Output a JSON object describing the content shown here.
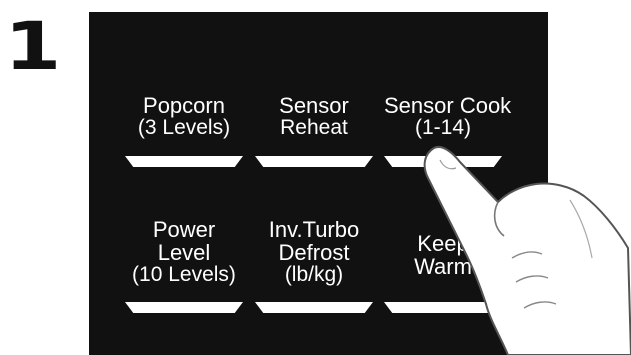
{
  "step_number": "1",
  "buttons": [
    {
      "id": "popcorn",
      "line1": "Popcorn",
      "line2": "(3 Levels)"
    },
    {
      "id": "sensor-reheat",
      "line1": "Sensor",
      "line2": "Reheat"
    },
    {
      "id": "sensor-cook",
      "line1": "Sensor Cook",
      "line2": "(1-14)"
    },
    {
      "id": "power-level",
      "line1": "Power",
      "line2": "Level",
      "line3": "(10 Levels)"
    },
    {
      "id": "inv-turbo-defrost",
      "line1": "Inv.Turbo",
      "line2": "Defrost",
      "line3": "(lb/kg)"
    },
    {
      "id": "keep-warm",
      "line1": "Keep",
      "line2": "Warm"
    }
  ]
}
